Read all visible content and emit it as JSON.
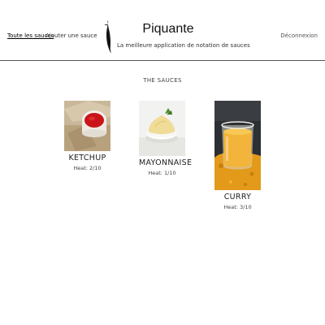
{
  "nav": {
    "all_sauces": "Toute les sauces",
    "add_sauce": "Ajouter une sauce",
    "logout": "Déconnexion"
  },
  "brand": {
    "title": "Piquante",
    "subtitle": "La meilleure application de notation de sauces"
  },
  "section_title": "THE SAUCES",
  "sauces": [
    {
      "name": "KETCHUP",
      "heat": "Heat: 2/10",
      "icon": "ketchup-bowl-image"
    },
    {
      "name": "MAYONNAISE",
      "heat": "Heat: 1/10",
      "icon": "mayonnaise-bowl-image"
    },
    {
      "name": "CURRY",
      "heat": "Heat: 3/10",
      "icon": "curry-jar-image"
    }
  ]
}
